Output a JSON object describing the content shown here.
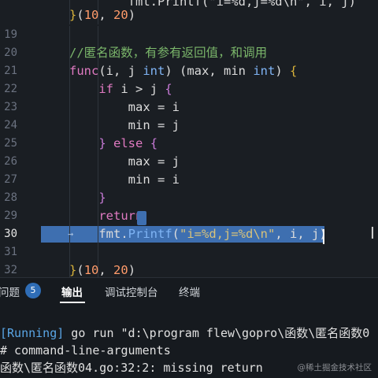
{
  "editor": {
    "lines": [
      {
        "n": "",
        "tokens": [
          {
            "t": "        fmt.Printf(\"i=%d,j=%d\\n\", i, j)",
            "c": ""
          }
        ],
        "partial": true
      },
      {
        "n": "",
        "tokens": [
          {
            "t": "}",
            "c": "tk-br"
          },
          {
            "t": "(",
            "c": ""
          },
          {
            "t": "10",
            "c": "tk-num"
          },
          {
            "t": ", ",
            "c": ""
          },
          {
            "t": "20",
            "c": "tk-num"
          },
          {
            "t": ")",
            "c": ""
          }
        ]
      },
      {
        "n": "19",
        "tokens": []
      },
      {
        "n": "20",
        "tokens": [
          {
            "t": "//匿名函数，有参有返回值，和调用",
            "c": "tk-cm"
          }
        ]
      },
      {
        "n": "21",
        "tokens": [
          {
            "t": "func",
            "c": "tk-kw"
          },
          {
            "t": "(i, j ",
            "c": ""
          },
          {
            "t": "int",
            "c": "tk-type"
          },
          {
            "t": ") (max, min ",
            "c": ""
          },
          {
            "t": "int",
            "c": "tk-type"
          },
          {
            "t": ") ",
            "c": ""
          },
          {
            "t": "{",
            "c": "tk-br"
          }
        ]
      },
      {
        "n": "22",
        "tokens": [
          {
            "t": "    ",
            "c": ""
          },
          {
            "t": "if",
            "c": "tk-kw"
          },
          {
            "t": " i > j ",
            "c": ""
          },
          {
            "t": "{",
            "c": "tk-br2"
          }
        ]
      },
      {
        "n": "23",
        "tokens": [
          {
            "t": "        max = i",
            "c": ""
          }
        ]
      },
      {
        "n": "24",
        "tokens": [
          {
            "t": "        min = j",
            "c": ""
          }
        ]
      },
      {
        "n": "25",
        "tokens": [
          {
            "t": "    ",
            "c": ""
          },
          {
            "t": "}",
            "c": "tk-br2"
          },
          {
            "t": " ",
            "c": ""
          },
          {
            "t": "else",
            "c": "tk-kw"
          },
          {
            "t": " ",
            "c": ""
          },
          {
            "t": "{",
            "c": "tk-br2"
          }
        ]
      },
      {
        "n": "26",
        "tokens": [
          {
            "t": "        max = j",
            "c": ""
          }
        ]
      },
      {
        "n": "27",
        "tokens": [
          {
            "t": "        min = i",
            "c": ""
          }
        ]
      },
      {
        "n": "28",
        "tokens": [
          {
            "t": "    ",
            "c": ""
          },
          {
            "t": "}",
            "c": "tk-br2"
          }
        ]
      },
      {
        "n": "29",
        "tokens": [
          {
            "t": "    ",
            "c": ""
          },
          {
            "t": "return",
            "c": "tk-kw"
          }
        ]
      },
      {
        "n": "30",
        "tokens": [
          {
            "t": "    fmt.",
            "c": ""
          },
          {
            "t": "Printf",
            "c": "tk-fn"
          },
          {
            "t": "(",
            "c": ""
          },
          {
            "t": "\"i=%d,j=%d\\n\"",
            "c": "tk-str"
          },
          {
            "t": ", i, j)",
            "c": ""
          }
        ],
        "selected": true
      },
      {
        "n": "31",
        "tokens": []
      },
      {
        "n": "32",
        "tokens": [
          {
            "t": "}",
            "c": "tk-br"
          },
          {
            "t": "(",
            "c": ""
          },
          {
            "t": "10",
            "c": "tk-num"
          },
          {
            "t": ", ",
            "c": ""
          },
          {
            "t": "20",
            "c": "tk-num"
          },
          {
            "t": ")",
            "c": ""
          }
        ]
      }
    ]
  },
  "panel": {
    "problems_label": "问题",
    "problems_count": "5",
    "output_label": "输出",
    "debug_console_label": "调试控制台",
    "terminal_label": "终端"
  },
  "terminal": {
    "line1_tag": "[Running]",
    "line1_text": " go run \"d:\\program flew\\gopro\\函数\\匿名函数0",
    "line2_text": "# command-line-arguments",
    "line3_text": "函数\\匿名函数04.go:32:2: missing return"
  },
  "watermark": "@稀土掘金技术社区"
}
